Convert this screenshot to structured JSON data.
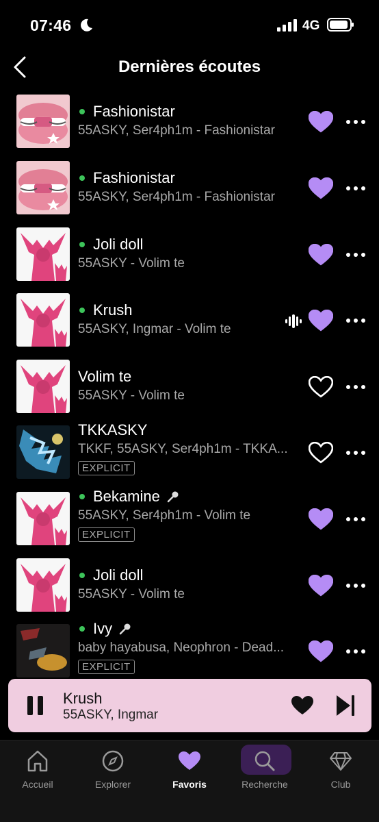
{
  "status_bar": {
    "time": "07:46",
    "network": "4G"
  },
  "header": {
    "title": "Dernières écoutes"
  },
  "tracks": [
    {
      "title": "Fashionistar",
      "subtitle": "55ASKY, Ser4ph1m - Fashionistar",
      "downloaded": true,
      "liked": true,
      "explicit": false,
      "art": "lips"
    },
    {
      "title": "Fashionistar",
      "subtitle": "55ASKY, Ser4ph1m - Fashionistar",
      "downloaded": true,
      "liked": true,
      "explicit": false,
      "art": "lips"
    },
    {
      "title": "Joli doll",
      "subtitle": "55ASKY - Volim te",
      "downloaded": true,
      "liked": true,
      "explicit": false,
      "art": "pink"
    },
    {
      "title": "Krush",
      "subtitle": "55ASKY, Ingmar - Volim te",
      "downloaded": true,
      "liked": true,
      "explicit": false,
      "art": "pink",
      "playing": true
    },
    {
      "title": "Volim te",
      "subtitle": "55ASKY - Volim te",
      "downloaded": false,
      "liked": false,
      "explicit": false,
      "art": "pink"
    },
    {
      "title": "TKKASKY",
      "subtitle": "TKKF, 55ASKY, Ser4ph1m - TKKA...",
      "downloaded": false,
      "liked": false,
      "explicit": true,
      "explicit_label": "EXPLICIT",
      "art": "blue"
    },
    {
      "title": "Bekamine",
      "subtitle": "55ASKY, Ser4ph1m - Volim te",
      "downloaded": true,
      "liked": true,
      "explicit": true,
      "explicit_label": "EXPLICIT",
      "lyrics": true,
      "art": "pink"
    },
    {
      "title": "Joli doll",
      "subtitle": "55ASKY - Volim te",
      "downloaded": true,
      "liked": true,
      "explicit": false,
      "art": "pink"
    },
    {
      "title": "Ivy",
      "subtitle": "baby hayabusa, Neophron - Dead...",
      "downloaded": true,
      "liked": true,
      "explicit": true,
      "explicit_label": "EXPLICIT",
      "lyrics": true,
      "art": "dark"
    }
  ],
  "player": {
    "title": "Krush",
    "artist": "55ASKY, Ingmar",
    "liked": true
  },
  "tabs": [
    {
      "label": "Accueil",
      "icon": "home-icon"
    },
    {
      "label": "Explorer",
      "icon": "compass-icon"
    },
    {
      "label": "Favoris",
      "icon": "heart-icon",
      "active": true
    },
    {
      "label": "Recherche",
      "icon": "search-icon"
    },
    {
      "label": "Club",
      "icon": "diamond-icon"
    }
  ],
  "colors": {
    "accent": "#b58cf5",
    "downloaded_dot": "#3dc45a",
    "player_bg": "#f0cde0",
    "active_tab_bg": "#3b1f55"
  }
}
